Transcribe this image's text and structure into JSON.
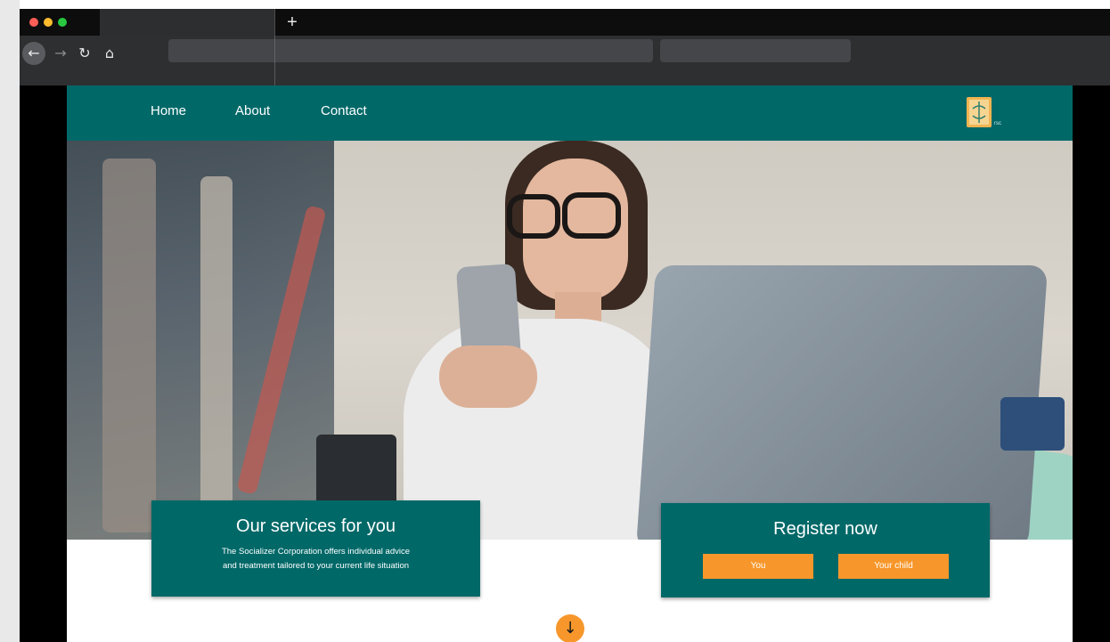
{
  "browser": {
    "new_tab_label": "+",
    "back_icon": "←",
    "forward_icon": "→",
    "reload_icon": "↻",
    "home_icon": "⌂"
  },
  "site": {
    "nav": [
      {
        "label": "Home"
      },
      {
        "label": "About"
      },
      {
        "label": "Contact"
      }
    ],
    "logo_sub": "rsc"
  },
  "services_card": {
    "title": "Our services for you",
    "line1": "The Socializer Corporation offers individual advice",
    "line2": "and treatment tailored to your current life situation"
  },
  "register_card": {
    "title": "Register now",
    "button_you": "You",
    "button_child": "Your child"
  },
  "scroll_icon": "↓",
  "colors": {
    "brand_teal": "#016868",
    "accent_orange": "#f7972b"
  }
}
